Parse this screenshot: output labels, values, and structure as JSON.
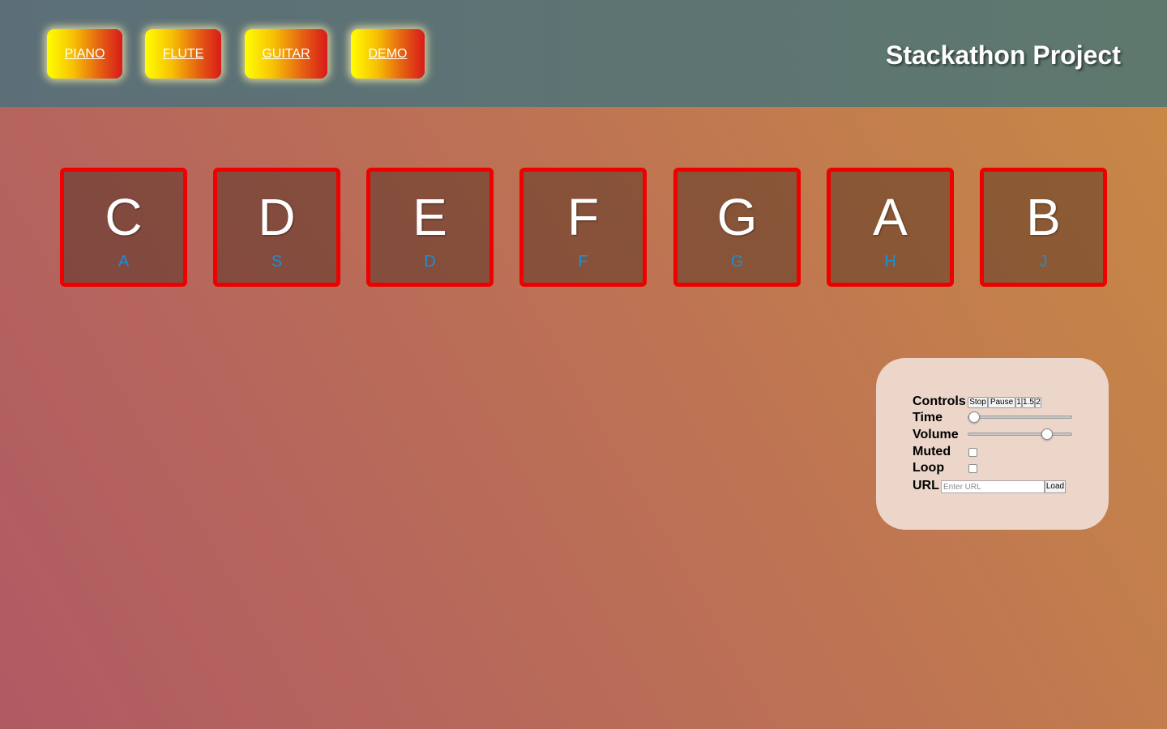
{
  "header": {
    "nav": [
      {
        "label": "PIANO"
      },
      {
        "label": "FLUTE"
      },
      {
        "label": "GUITAR"
      },
      {
        "label": "DEMO"
      }
    ],
    "title": "Stackathon Project"
  },
  "keys": [
    {
      "note": "C",
      "shortcut": "A"
    },
    {
      "note": "D",
      "shortcut": "S"
    },
    {
      "note": "E",
      "shortcut": "D"
    },
    {
      "note": "F",
      "shortcut": "F"
    },
    {
      "note": "G",
      "shortcut": "G"
    },
    {
      "note": "A",
      "shortcut": "H"
    },
    {
      "note": "B",
      "shortcut": "J"
    }
  ],
  "controls": {
    "controls_label": "Controls",
    "buttons": [
      "Stop",
      "Pause",
      "1",
      "1.5",
      "2"
    ],
    "time_label": "Time",
    "time_value": 0,
    "volume_label": "Volume",
    "volume_value": 0.8,
    "muted_label": "Muted",
    "muted_checked": false,
    "loop_label": "Loop",
    "loop_checked": false,
    "url_label": "URL",
    "url_placeholder": "Enter URL",
    "url_value": "",
    "load_label": "Load"
  },
  "colors": {
    "key_border": "#ee0000",
    "shortcut_text": "#1a8fd6",
    "panel_bg": "#ecd6ca"
  }
}
